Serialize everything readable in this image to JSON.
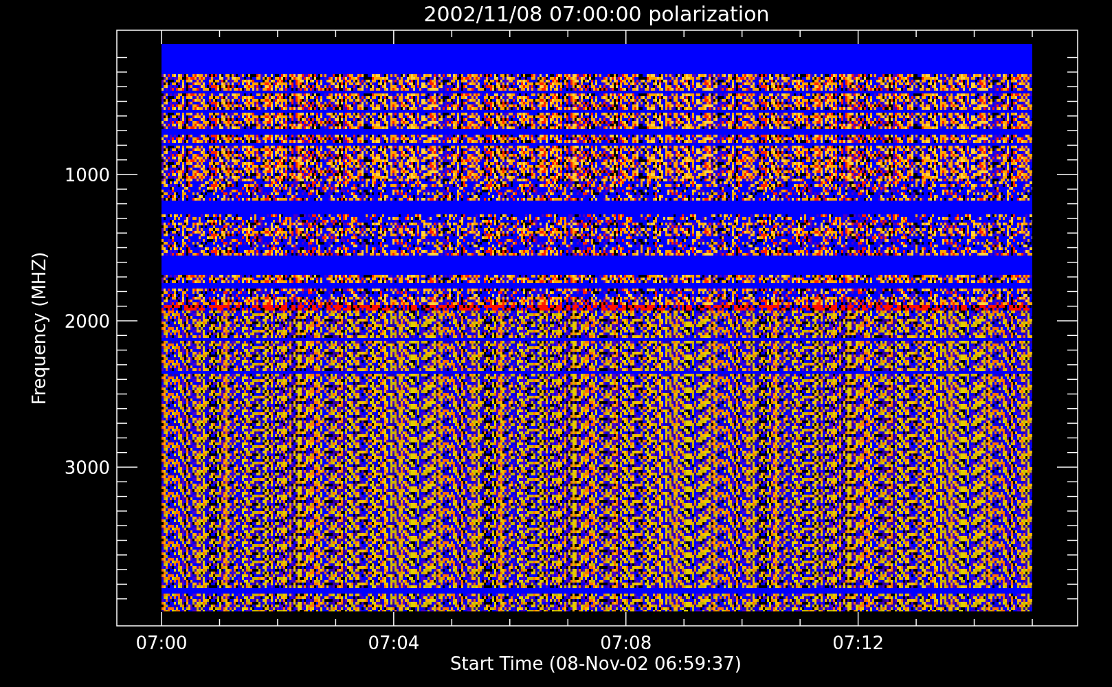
{
  "title": "2002/11/08 07:00:00 polarization",
  "y_axis": {
    "label": "Frequency (MHZ)",
    "ticks": [
      "1000",
      "2000",
      "3000"
    ]
  },
  "x_axis": {
    "label": "Start Time (08-Nov-02 06:59:37)",
    "ticks": [
      "07:00",
      "07:04",
      "07:08",
      "07:12"
    ]
  }
}
